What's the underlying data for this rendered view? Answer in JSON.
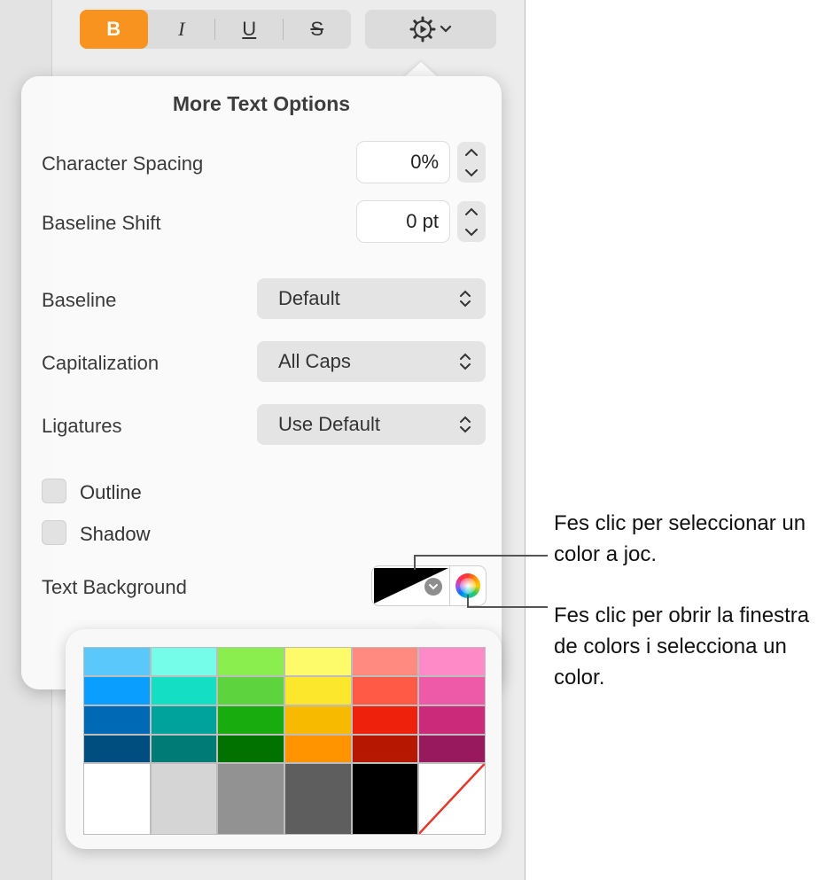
{
  "toolbar": {
    "bold_label": "B",
    "italic_label": "I",
    "underline_label": "U",
    "strike_label": "S",
    "gear_icon": "gear-play-icon",
    "accent_color": "#f7931e"
  },
  "popover": {
    "title": "More Text Options",
    "character_spacing": {
      "label": "Character Spacing",
      "value": "0%"
    },
    "baseline_shift": {
      "label": "Baseline Shift",
      "value": "0 pt"
    },
    "baseline": {
      "label": "Baseline",
      "value": "Default"
    },
    "capitalization": {
      "label": "Capitalization",
      "value": "All Caps"
    },
    "ligatures": {
      "label": "Ligatures",
      "value": "Use Default"
    },
    "outline": {
      "label": "Outline",
      "checked": false
    },
    "shadow": {
      "label": "Shadow",
      "checked": false
    },
    "text_background": {
      "label": "Text Background",
      "swatch": "black-white-diagonal"
    }
  },
  "palette": {
    "rows": [
      [
        "#5ac8fa",
        "#76fdea",
        "#8aef4e",
        "#fefb6b",
        "#ff8a80",
        "#ff8ac8"
      ],
      [
        "#0a9eff",
        "#14dec3",
        "#5dd43d",
        "#fde72c",
        "#ff5a46",
        "#ef5aa8"
      ],
      [
        "#0069b5",
        "#00a39b",
        "#19ac0f",
        "#f8ba00",
        "#ee220c",
        "#cb2a7b"
      ],
      [
        "#004d80",
        "#017b76",
        "#017100",
        "#ff9300",
        "#b51700",
        "#99195e"
      ],
      [
        "#ffffff",
        "#d5d5d5",
        "#929292",
        "#5e5e5e",
        "#000000",
        "none"
      ]
    ]
  },
  "callouts": {
    "preset": "Fes clic per seleccionar un color a joc.",
    "window": "Fes clic per obrir la finestra de colors i selecciona un color."
  }
}
